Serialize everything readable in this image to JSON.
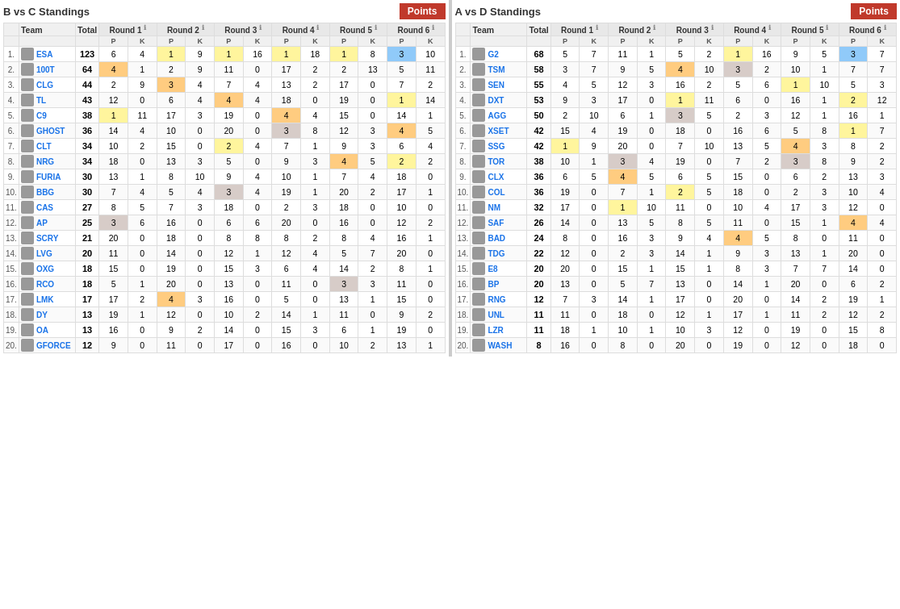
{
  "leftPanel": {
    "title": "B vs C Standings",
    "pointsBtn": "Points",
    "headers": {
      "rank": "",
      "team": "Team",
      "total": "Total",
      "rounds": [
        "Round 1",
        "Round 2",
        "Round 3",
        "Round 4",
        "Round 5",
        "Round 6"
      ]
    },
    "subHeaders": [
      "P",
      "K",
      "P",
      "K",
      "P",
      "K",
      "P",
      "K",
      "P",
      "K",
      "P",
      "K"
    ],
    "rows": [
      {
        "rank": "1.",
        "icon": "ESA",
        "name": "ESA",
        "total": "123",
        "r1p": "6",
        "r1k": "4",
        "r2p": "1",
        "r2k": "9",
        "r3p": "1",
        "r3k": "16",
        "r4p": "1",
        "r4k": "18",
        "r5p": "1",
        "r5k": "8",
        "r6p": "3",
        "r6k": "10",
        "h_r2p": "yellow",
        "h_r3p": "yellow",
        "h_r4p": "yellow",
        "h_r5p": "yellow",
        "h_r6p": "blue"
      },
      {
        "rank": "2.",
        "icon": "100T",
        "name": "100T",
        "total": "64",
        "r1p": "4",
        "r1k": "1",
        "r2p": "2",
        "r2k": "9",
        "r3p": "11",
        "r3k": "0",
        "r4p": "17",
        "r4k": "2",
        "r5p": "2",
        "r5k": "13",
        "r6p": "5",
        "r6k": "11",
        "h_r1p": "orange"
      },
      {
        "rank": "3.",
        "icon": "CLG",
        "name": "CLG",
        "total": "44",
        "r1p": "2",
        "r1k": "9",
        "r2p": "3",
        "r2k": "4",
        "r3p": "7",
        "r3k": "4",
        "r4p": "13",
        "r4k": "2",
        "r5p": "17",
        "r5k": "0",
        "r6p": "7",
        "r6k": "2",
        "h_r2p": "orange"
      },
      {
        "rank": "4.",
        "icon": "TL",
        "name": "TL",
        "total": "43",
        "r1p": "12",
        "r1k": "0",
        "r2p": "6",
        "r2k": "4",
        "r3p": "4",
        "r3k": "4",
        "r4p": "18",
        "r4k": "0",
        "r5p": "19",
        "r5k": "0",
        "r6p": "1",
        "r6k": "14",
        "h_r3p": "orange",
        "h_r6p": "yellow"
      },
      {
        "rank": "5.",
        "icon": "C9",
        "name": "C9",
        "total": "38",
        "r1p": "1",
        "r1k": "11",
        "r2p": "17",
        "r2k": "3",
        "r3p": "19",
        "r3k": "0",
        "r4p": "4",
        "r4k": "4",
        "r5p": "15",
        "r5k": "0",
        "r6p": "14",
        "r6k": "1",
        "h_r1p": "yellow",
        "h_r4p": "orange"
      },
      {
        "rank": "6.",
        "icon": "GHOST",
        "name": "GHOST",
        "total": "36",
        "r1p": "14",
        "r1k": "4",
        "r2p": "10",
        "r2k": "0",
        "r3p": "20",
        "r3k": "0",
        "r4p": "3",
        "r4k": "8",
        "r5p": "12",
        "r5k": "3",
        "r6p": "4",
        "r6k": "5",
        "h_r4p": "tan",
        "h_r6p": "orange"
      },
      {
        "rank": "7.",
        "icon": "CLT",
        "name": "CLT",
        "total": "34",
        "r1p": "10",
        "r1k": "2",
        "r2p": "15",
        "r2k": "0",
        "r3p": "2",
        "r3k": "4",
        "r4p": "7",
        "r4k": "1",
        "r5p": "9",
        "r5k": "3",
        "r6p": "6",
        "r6k": "4",
        "h_r3p": "yellow"
      },
      {
        "rank": "8.",
        "icon": "NRG",
        "name": "NRG",
        "total": "34",
        "r1p": "18",
        "r1k": "0",
        "r2p": "13",
        "r2k": "3",
        "r3p": "5",
        "r3k": "0",
        "r4p": "9",
        "r4k": "3",
        "r5p": "4",
        "r5k": "5",
        "r6p": "2",
        "r6k": "2",
        "h_r5p": "orange",
        "h_r6p": "yellow"
      },
      {
        "rank": "9.",
        "icon": "FURIA",
        "name": "FURIA",
        "total": "30",
        "r1p": "13",
        "r1k": "1",
        "r2p": "8",
        "r2k": "10",
        "r3p": "9",
        "r3k": "4",
        "r4p": "10",
        "r4k": "1",
        "r5p": "7",
        "r5k": "4",
        "r6p": "18",
        "r6k": "0"
      },
      {
        "rank": "10.",
        "icon": "BBG",
        "name": "BBG",
        "total": "30",
        "r1p": "7",
        "r1k": "4",
        "r2p": "5",
        "r2k": "4",
        "r3p": "3",
        "r3k": "4",
        "r4p": "19",
        "r4k": "1",
        "r5p": "20",
        "r5k": "2",
        "r6p": "17",
        "r6k": "1",
        "h_r3p": "tan"
      },
      {
        "rank": "11.",
        "icon": "CAS",
        "name": "CAS",
        "total": "27",
        "r1p": "8",
        "r1k": "5",
        "r2p": "7",
        "r2k": "3",
        "r3p": "18",
        "r3k": "0",
        "r4p": "2",
        "r4k": "3",
        "r5p": "18",
        "r5k": "0",
        "r6p": "10",
        "r6k": "0"
      },
      {
        "rank": "12.",
        "icon": "AP",
        "name": "AP",
        "total": "25",
        "r1p": "3",
        "r1k": "6",
        "r2p": "16",
        "r2k": "0",
        "r3p": "6",
        "r3k": "6",
        "r4p": "20",
        "r4k": "0",
        "r5p": "16",
        "r5k": "0",
        "r6p": "12",
        "r6k": "2",
        "h_r1p": "tan"
      },
      {
        "rank": "13.",
        "icon": "SCRY",
        "name": "SCRY",
        "total": "21",
        "r1p": "20",
        "r1k": "0",
        "r2p": "18",
        "r2k": "0",
        "r3p": "8",
        "r3k": "8",
        "r4p": "8",
        "r4k": "2",
        "r5p": "8",
        "r5k": "4",
        "r6p": "16",
        "r6k": "1"
      },
      {
        "rank": "14.",
        "icon": "LVG",
        "name": "LVG",
        "total": "20",
        "r1p": "11",
        "r1k": "0",
        "r2p": "14",
        "r2k": "0",
        "r3p": "12",
        "r3k": "1",
        "r4p": "12",
        "r4k": "4",
        "r5p": "5",
        "r5k": "7",
        "r6p": "20",
        "r6k": "0"
      },
      {
        "rank": "15.",
        "icon": "OXG",
        "name": "OXG",
        "total": "18",
        "r1p": "15",
        "r1k": "0",
        "r2p": "19",
        "r2k": "0",
        "r3p": "15",
        "r3k": "3",
        "r4p": "6",
        "r4k": "4",
        "r5p": "14",
        "r5k": "2",
        "r6p": "8",
        "r6k": "1"
      },
      {
        "rank": "16.",
        "icon": "RCO",
        "name": "RCO",
        "total": "18",
        "r1p": "5",
        "r1k": "1",
        "r2p": "20",
        "r2k": "0",
        "r3p": "13",
        "r3k": "0",
        "r4p": "11",
        "r4k": "0",
        "r5p": "3",
        "r5k": "3",
        "r6p": "11",
        "r6k": "0",
        "h_r5p": "tan"
      },
      {
        "rank": "17.",
        "icon": "LMK",
        "name": "LMK",
        "total": "17",
        "r1p": "17",
        "r1k": "2",
        "r2p": "4",
        "r2k": "3",
        "r3p": "16",
        "r3k": "0",
        "r4p": "5",
        "r4k": "0",
        "r5p": "13",
        "r5k": "1",
        "r6p": "15",
        "r6k": "0",
        "h_r2p": "orange"
      },
      {
        "rank": "18.",
        "icon": "DY",
        "name": "DY",
        "total": "13",
        "r1p": "19",
        "r1k": "1",
        "r2p": "12",
        "r2k": "0",
        "r3p": "10",
        "r3k": "2",
        "r4p": "14",
        "r4k": "1",
        "r5p": "11",
        "r5k": "0",
        "r6p": "9",
        "r6k": "2"
      },
      {
        "rank": "19.",
        "icon": "OA",
        "name": "OA",
        "total": "13",
        "r1p": "16",
        "r1k": "0",
        "r2p": "9",
        "r2k": "2",
        "r3p": "14",
        "r3k": "0",
        "r4p": "15",
        "r4k": "3",
        "r5p": "6",
        "r5k": "1",
        "r6p": "19",
        "r6k": "0"
      },
      {
        "rank": "20.",
        "icon": "GFORCE",
        "name": "GFORCE",
        "total": "12",
        "r1p": "9",
        "r1k": "0",
        "r2p": "11",
        "r2k": "0",
        "r3p": "17",
        "r3k": "0",
        "r4p": "16",
        "r4k": "0",
        "r5p": "10",
        "r5k": "2",
        "r6p": "13",
        "r6k": "1"
      }
    ]
  },
  "rightPanel": {
    "title": "A vs D Standings",
    "pointsBtn": "Points",
    "headers": {
      "rounds": [
        "Round 1",
        "Round 2",
        "Round 3",
        "Round 4",
        "Round 5",
        "Round 6"
      ]
    },
    "rows": [
      {
        "rank": "1.",
        "icon": "G2",
        "name": "G2",
        "total": "68",
        "r1p": "5",
        "r1k": "7",
        "r2p": "11",
        "r2k": "1",
        "r3p": "5",
        "r3k": "2",
        "r4p": "1",
        "r4k": "16",
        "r5p": "9",
        "r5k": "5",
        "r6p": "3",
        "r6k": "7",
        "h_r4p": "yellow",
        "h_r6p": "blue"
      },
      {
        "rank": "2.",
        "icon": "TSM",
        "name": "TSM",
        "total": "58",
        "r1p": "3",
        "r1k": "7",
        "r2p": "9",
        "r2k": "5",
        "r3p": "4",
        "r3k": "10",
        "r4p": "3",
        "r4k": "2",
        "r5p": "10",
        "r5k": "1",
        "r6p": "7",
        "r6k": "7",
        "h_r3p": "orange",
        "h_r4p": "tan"
      },
      {
        "rank": "3.",
        "icon": "SEN",
        "name": "SEN",
        "total": "55",
        "r1p": "4",
        "r1k": "5",
        "r2p": "12",
        "r2k": "3",
        "r3p": "16",
        "r3k": "2",
        "r4p": "5",
        "r4k": "6",
        "r5p": "1",
        "r5k": "10",
        "r6p": "5",
        "r6k": "3",
        "h_r5p": "yellow"
      },
      {
        "rank": "4.",
        "icon": "DXT",
        "name": "DXT",
        "total": "53",
        "r1p": "9",
        "r1k": "3",
        "r2p": "17",
        "r2k": "0",
        "r3p": "1",
        "r3k": "11",
        "r4p": "6",
        "r4k": "0",
        "r5p": "16",
        "r5k": "1",
        "r6p": "2",
        "r6k": "12",
        "h_r3p": "yellow",
        "h_r6p": "yellow"
      },
      {
        "rank": "5.",
        "icon": "AGG",
        "name": "AGG",
        "total": "50",
        "r1p": "2",
        "r1k": "10",
        "r2p": "6",
        "r2k": "1",
        "r3p": "3",
        "r3k": "5",
        "r4p": "2",
        "r4k": "3",
        "r5p": "12",
        "r5k": "1",
        "r6p": "16",
        "r6k": "1",
        "h_r3p": "tan"
      },
      {
        "rank": "6.",
        "icon": "XSET",
        "name": "XSET",
        "total": "42",
        "r1p": "15",
        "r1k": "4",
        "r2p": "19",
        "r2k": "0",
        "r3p": "18",
        "r3k": "0",
        "r4p": "16",
        "r4k": "6",
        "r5p": "5",
        "r5k": "8",
        "r6p": "1",
        "r6k": "7",
        "h_r6p": "yellow"
      },
      {
        "rank": "7.",
        "icon": "SSG",
        "name": "SSG",
        "total": "42",
        "r1p": "1",
        "r1k": "9",
        "r2p": "20",
        "r2k": "0",
        "r3p": "7",
        "r3k": "10",
        "r4p": "13",
        "r4k": "5",
        "r5p": "4",
        "r5k": "3",
        "r6p": "8",
        "r6k": "2",
        "h_r1p": "yellow",
        "h_r5p": "orange"
      },
      {
        "rank": "8.",
        "icon": "TOR",
        "name": "TOR",
        "total": "38",
        "r1p": "10",
        "r1k": "1",
        "r2p": "3",
        "r2k": "4",
        "r3p": "19",
        "r3k": "0",
        "r4p": "7",
        "r4k": "2",
        "r5p": "3",
        "r5k": "8",
        "r6p": "9",
        "r6k": "2",
        "h_r2p": "tan",
        "h_r5p": "tan"
      },
      {
        "rank": "9.",
        "icon": "CLX",
        "name": "CLX",
        "total": "36",
        "r1p": "6",
        "r1k": "5",
        "r2p": "4",
        "r2k": "5",
        "r3p": "6",
        "r3k": "5",
        "r4p": "15",
        "r4k": "0",
        "r5p": "6",
        "r5k": "2",
        "r6p": "13",
        "r6k": "3",
        "h_r2p": "orange"
      },
      {
        "rank": "10.",
        "icon": "COL",
        "name": "COL",
        "total": "36",
        "r1p": "19",
        "r1k": "0",
        "r2p": "7",
        "r2k": "1",
        "r3p": "2",
        "r3k": "5",
        "r4p": "18",
        "r4k": "0",
        "r5p": "2",
        "r5k": "3",
        "r6p": "10",
        "r6k": "4",
        "h_r3p": "yellow"
      },
      {
        "rank": "11.",
        "icon": "NM",
        "name": "NM",
        "total": "32",
        "r1p": "17",
        "r1k": "0",
        "r2p": "1",
        "r2k": "10",
        "r3p": "11",
        "r3k": "0",
        "r4p": "10",
        "r4k": "4",
        "r5p": "17",
        "r5k": "3",
        "r6p": "12",
        "r6k": "0",
        "h_r2p": "yellow"
      },
      {
        "rank": "12.",
        "icon": "SAF",
        "name": "SAF",
        "total": "26",
        "r1p": "14",
        "r1k": "0",
        "r2p": "13",
        "r2k": "5",
        "r3p": "8",
        "r3k": "5",
        "r4p": "11",
        "r4k": "0",
        "r5p": "15",
        "r5k": "1",
        "r6p": "4",
        "r6k": "4",
        "h_r6p": "orange"
      },
      {
        "rank": "13.",
        "icon": "BAD",
        "name": "BAD",
        "total": "24",
        "r1p": "8",
        "r1k": "0",
        "r2p": "16",
        "r2k": "3",
        "r3p": "9",
        "r3k": "4",
        "r4p": "4",
        "r4k": "5",
        "r5p": "8",
        "r5k": "0",
        "r6p": "11",
        "r6k": "0",
        "h_r4p": "orange"
      },
      {
        "rank": "14.",
        "icon": "TDG",
        "name": "TDG",
        "total": "22",
        "r1p": "12",
        "r1k": "0",
        "r2p": "2",
        "r2k": "3",
        "r3p": "14",
        "r3k": "1",
        "r4p": "9",
        "r4k": "3",
        "r5p": "13",
        "r5k": "1",
        "r6p": "20",
        "r6k": "0"
      },
      {
        "rank": "15.",
        "icon": "E8",
        "name": "E8",
        "total": "20",
        "r1p": "20",
        "r1k": "0",
        "r2p": "15",
        "r2k": "1",
        "r3p": "15",
        "r3k": "1",
        "r4p": "8",
        "r4k": "3",
        "r5p": "7",
        "r5k": "7",
        "r6p": "14",
        "r6k": "0"
      },
      {
        "rank": "16.",
        "icon": "BP",
        "name": "BP",
        "total": "20",
        "r1p": "13",
        "r1k": "0",
        "r2p": "5",
        "r2k": "7",
        "r3p": "13",
        "r3k": "0",
        "r4p": "14",
        "r4k": "1",
        "r5p": "20",
        "r5k": "0",
        "r6p": "6",
        "r6k": "2"
      },
      {
        "rank": "17.",
        "icon": "RNG",
        "name": "RNG",
        "total": "12",
        "r1p": "7",
        "r1k": "3",
        "r2p": "14",
        "r2k": "1",
        "r3p": "17",
        "r3k": "0",
        "r4p": "20",
        "r4k": "0",
        "r5p": "14",
        "r5k": "2",
        "r6p": "19",
        "r6k": "1"
      },
      {
        "rank": "18.",
        "icon": "UNL",
        "name": "UNL",
        "total": "11",
        "r1p": "11",
        "r1k": "0",
        "r2p": "18",
        "r2k": "0",
        "r3p": "12",
        "r3k": "1",
        "r4p": "17",
        "r4k": "1",
        "r5p": "11",
        "r5k": "2",
        "r6p": "12",
        "r6k": "2"
      },
      {
        "rank": "19.",
        "icon": "LZR",
        "name": "LZR",
        "total": "11",
        "r1p": "18",
        "r1k": "1",
        "r2p": "10",
        "r2k": "1",
        "r3p": "10",
        "r3k": "3",
        "r4p": "12",
        "r4k": "0",
        "r5p": "19",
        "r5k": "0",
        "r6p": "15",
        "r6k": "8"
      },
      {
        "rank": "20.",
        "icon": "WASH",
        "name": "WASH",
        "total": "8",
        "r1p": "16",
        "r1k": "0",
        "r2p": "8",
        "r2k": "0",
        "r3p": "20",
        "r3k": "0",
        "r4p": "19",
        "r4k": "0",
        "r5p": "12",
        "r5k": "0",
        "r6p": "18",
        "r6k": "0"
      }
    ]
  }
}
